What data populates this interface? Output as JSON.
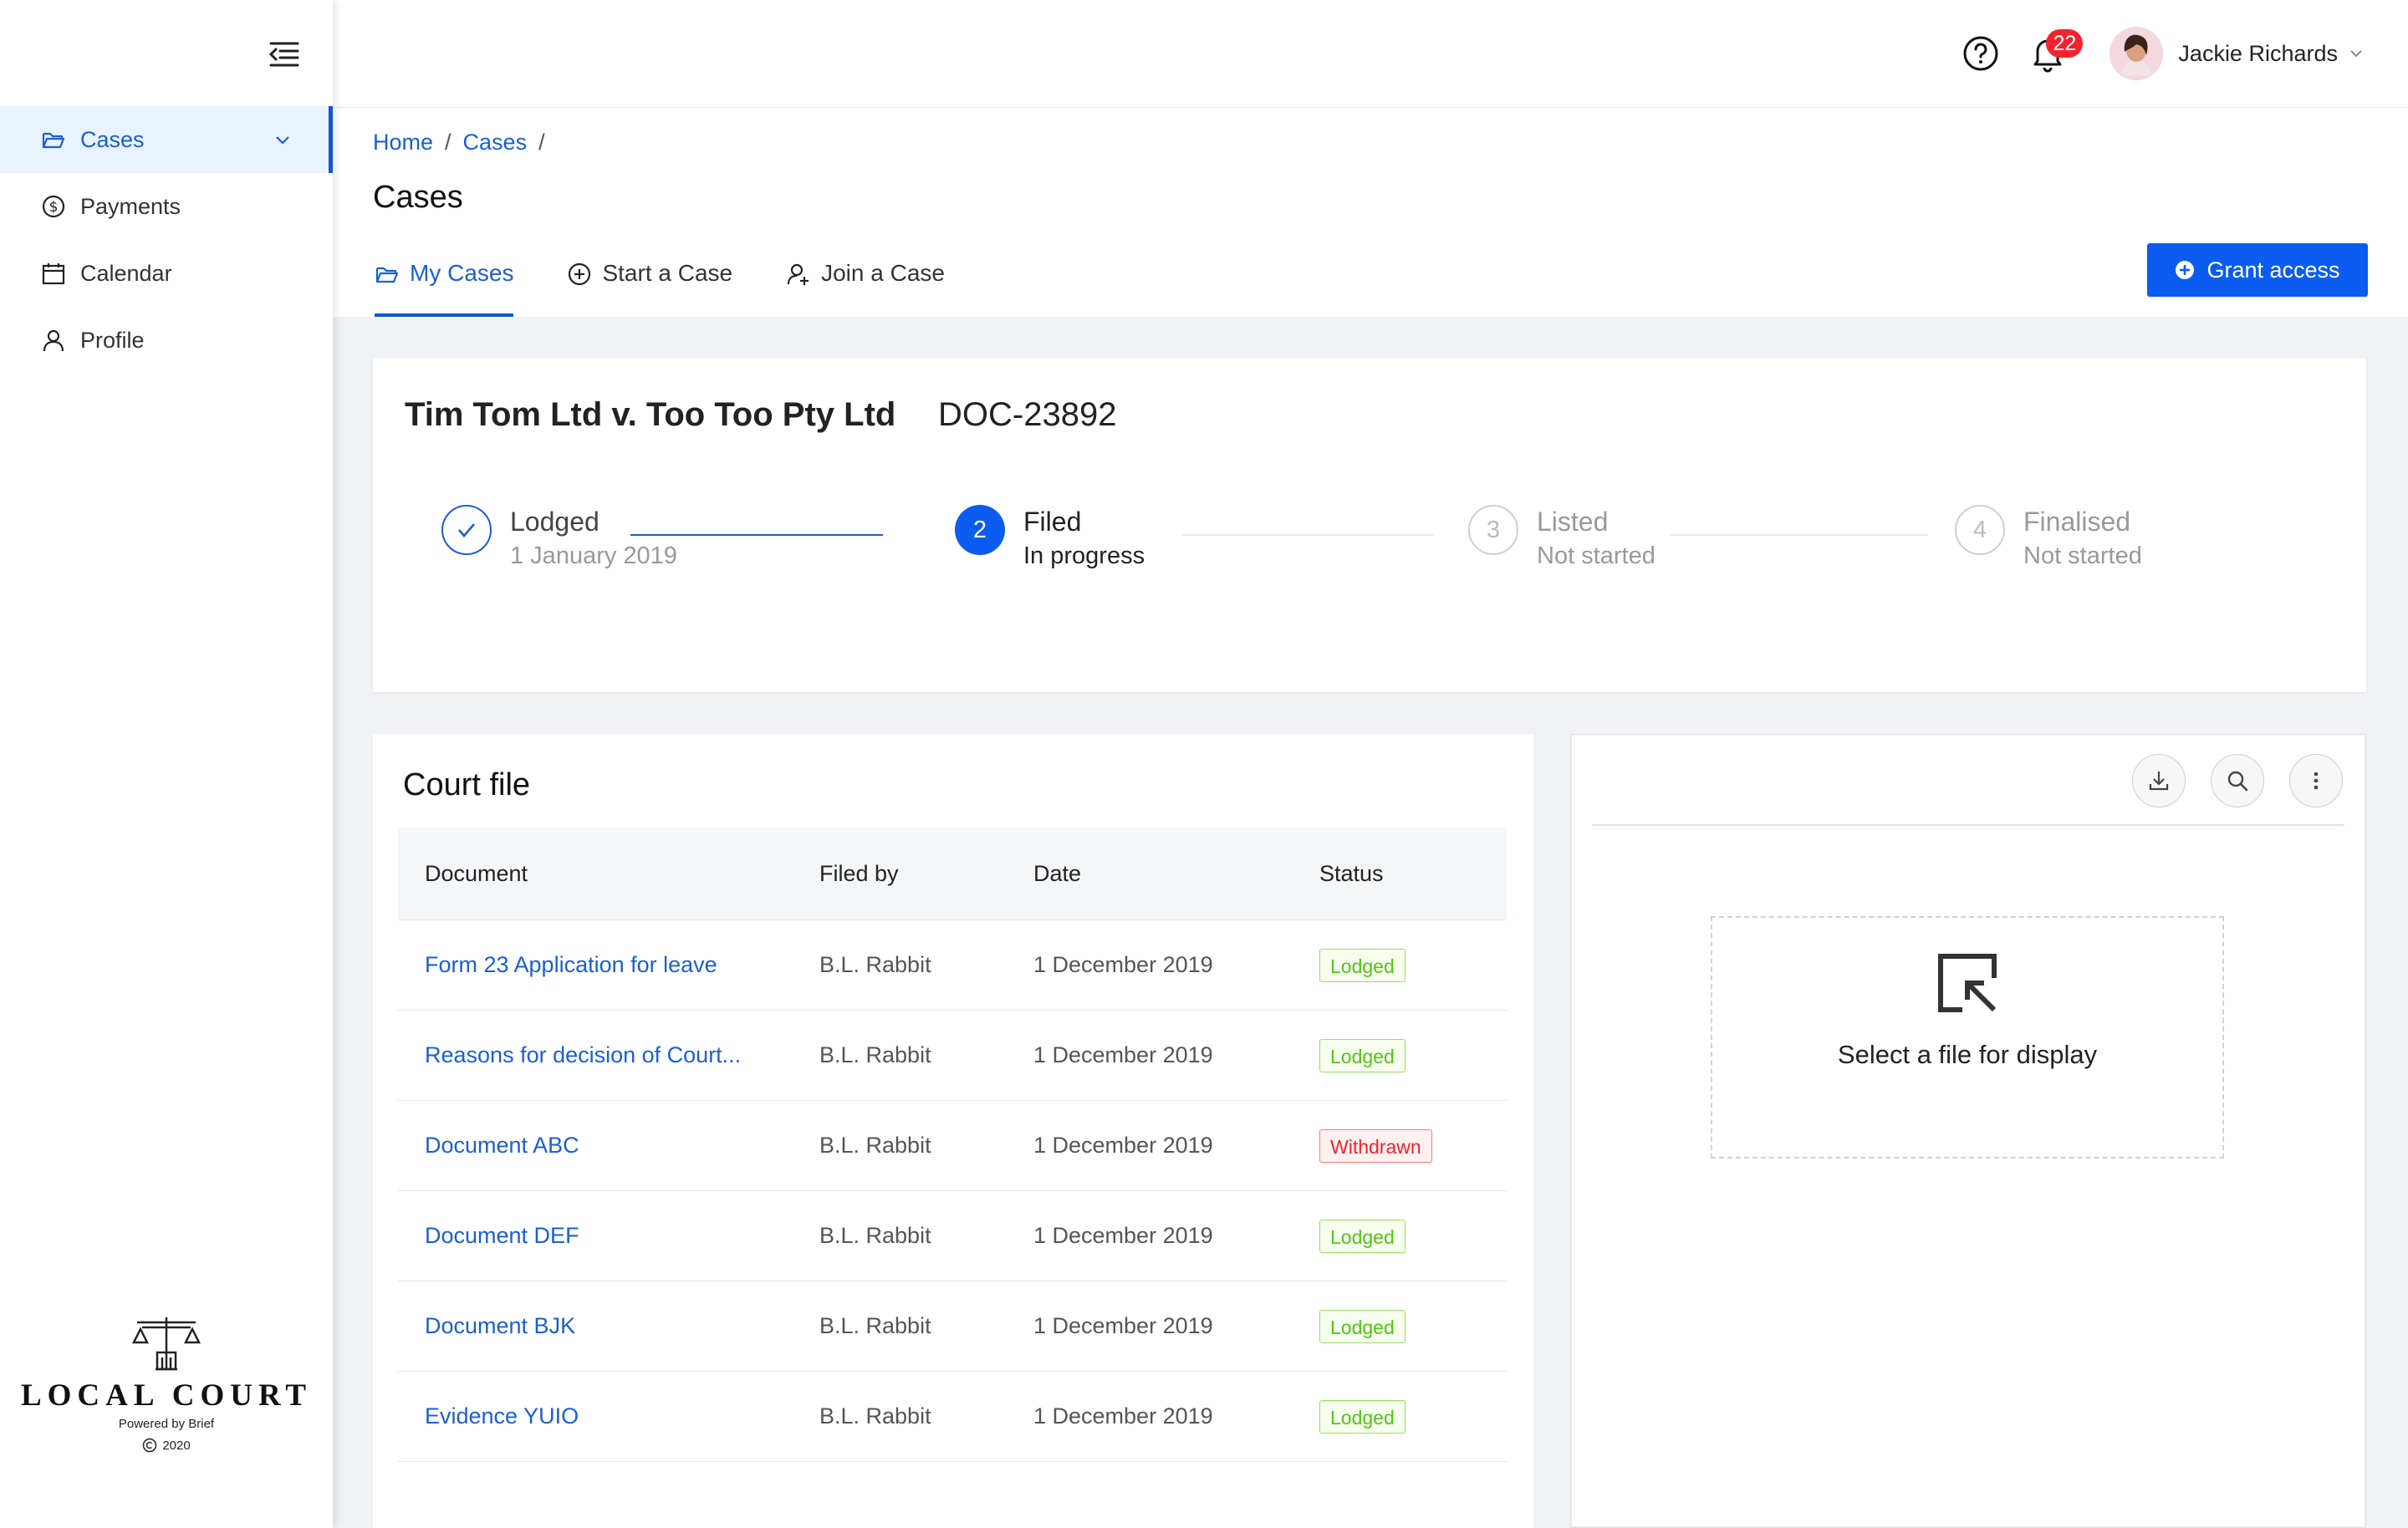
{
  "sidebar": {
    "items": [
      {
        "label": "Cases",
        "icon": "folder-open-icon",
        "active": true
      },
      {
        "label": "Payments",
        "icon": "dollar-circle-icon"
      },
      {
        "label": "Calendar",
        "icon": "calendar-icon"
      },
      {
        "label": "Profile",
        "icon": "user-icon"
      }
    ],
    "brand": {
      "name": "LOCAL COURT",
      "powered": "Powered by Brief",
      "copyright": "2020"
    }
  },
  "header": {
    "notifications_count": "22",
    "user_name": "Jackie Richards"
  },
  "breadcrumb": [
    "Home",
    "Cases"
  ],
  "breadcrumb_sep": "/",
  "page_title": "Cases",
  "tabs": [
    {
      "label": "My Cases",
      "icon": "folder-open-icon",
      "active": true
    },
    {
      "label": "Start a Case",
      "icon": "plus-circle-icon"
    },
    {
      "label": "Join a Case",
      "icon": "user-add-icon"
    }
  ],
  "grant_access_label": "Grant access",
  "case": {
    "title": "Tim Tom Ltd v. Too Too Pty Ltd",
    "id": "DOC-23892",
    "steps": [
      {
        "number": "1",
        "title": "Lodged",
        "subtitle": "1 January 2019",
        "state": "done"
      },
      {
        "number": "2",
        "title": "Filed",
        "subtitle": "In progress",
        "state": "active"
      },
      {
        "number": "3",
        "title": "Listed",
        "subtitle": "Not started",
        "state": "pending"
      },
      {
        "number": "4",
        "title": "Finalised",
        "subtitle": "Not started",
        "state": "pending"
      }
    ]
  },
  "court_file": {
    "title": "Court file",
    "columns": [
      "Document",
      "Filed by",
      "Date",
      "Status"
    ],
    "rows": [
      {
        "document": "Form 23 Application for leave",
        "filed_by": "B.L. Rabbit",
        "date": "1 December 2019",
        "status": "Lodged"
      },
      {
        "document": "Reasons for decision of Court...",
        "filed_by": "B.L. Rabbit",
        "date": "1 December 2019",
        "status": "Lodged"
      },
      {
        "document": "Document ABC",
        "filed_by": "B.L. Rabbit",
        "date": "1 December 2019",
        "status": "Withdrawn"
      },
      {
        "document": "Document DEF",
        "filed_by": "B.L. Rabbit",
        "date": "1 December 2019",
        "status": "Lodged"
      },
      {
        "document": "Document BJK",
        "filed_by": "B.L. Rabbit",
        "date": "1 December 2019",
        "status": "Lodged"
      },
      {
        "document": "Evidence YUIO",
        "filed_by": "B.L. Rabbit",
        "date": "1 December 2019",
        "status": "Lodged"
      }
    ]
  },
  "viewer": {
    "placeholder": "Select a file for display",
    "tools": [
      "download-icon",
      "search-icon",
      "more-vertical-icon"
    ]
  },
  "colors": {
    "primary": "#0b5cf0",
    "link": "#1a5fd6",
    "success": "#52c41a",
    "danger": "#f5222d"
  }
}
